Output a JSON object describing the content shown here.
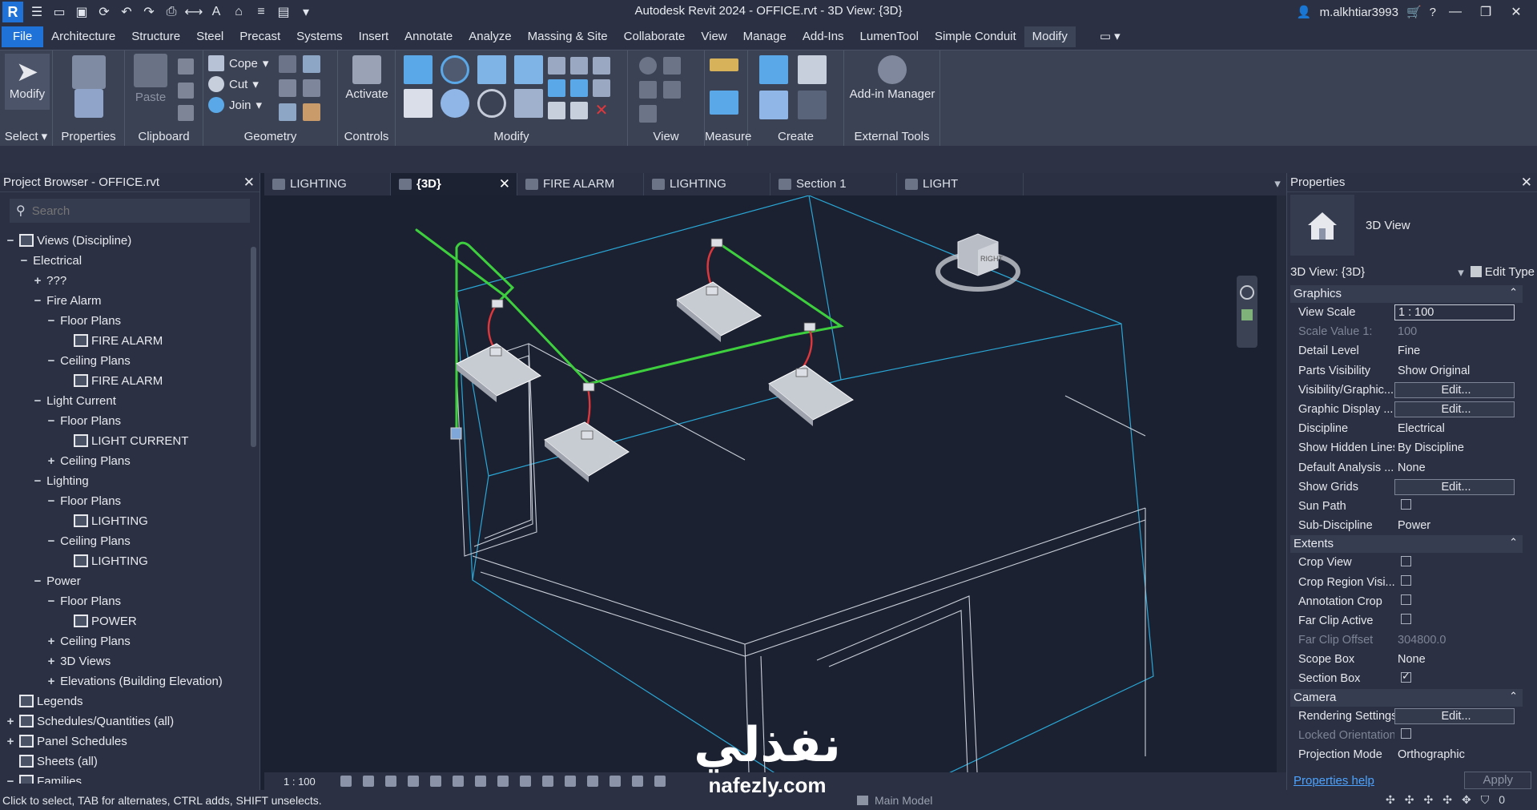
{
  "titlebar": {
    "title": "Autodesk Revit 2024 - OFFICE.rvt - 3D View: {3D}",
    "username": "m.alkhtiar3993"
  },
  "menu": {
    "tabs": [
      "File",
      "Architecture",
      "Structure",
      "Steel",
      "Precast",
      "Systems",
      "Insert",
      "Annotate",
      "Analyze",
      "Massing & Site",
      "Collaborate",
      "View",
      "Manage",
      "Add-Ins",
      "LumenTool",
      "Simple Conduit",
      "Modify"
    ],
    "active": "Modify"
  },
  "ribbon": {
    "modify_label": "Modify",
    "paste_label": "Paste",
    "cope_label": "Cope",
    "cut_label": "Cut",
    "join_label": "Join",
    "activate_label": "Activate",
    "addin_manager_label": "Add-in Manager",
    "panels": {
      "select": "Select",
      "properties": "Properties",
      "clipboard": "Clipboard",
      "geometry": "Geometry",
      "controls": "Controls",
      "modify": "Modify",
      "view": "View",
      "measure": "Measure",
      "create": "Create",
      "external_tools": "External Tools"
    }
  },
  "browser": {
    "title": "Project Browser - OFFICE.rvt",
    "search_placeholder": "Search",
    "items": [
      {
        "label": "Views (Discipline)",
        "level": 0,
        "toggle": "−",
        "icon": "views"
      },
      {
        "label": "Electrical",
        "level": 1,
        "toggle": "−"
      },
      {
        "label": "???",
        "level": 2,
        "toggle": "+"
      },
      {
        "label": "Fire Alarm",
        "level": 2,
        "toggle": "−"
      },
      {
        "label": "Floor Plans",
        "level": 3,
        "toggle": "−"
      },
      {
        "label": "FIRE ALARM",
        "level": 4,
        "icon": "plan"
      },
      {
        "label": "Ceiling Plans",
        "level": 3,
        "toggle": "−"
      },
      {
        "label": "FIRE ALARM",
        "level": 4,
        "icon": "plan"
      },
      {
        "label": "Light Current",
        "level": 2,
        "toggle": "−"
      },
      {
        "label": "Floor Plans",
        "level": 3,
        "toggle": "−"
      },
      {
        "label": "LIGHT CURRENT",
        "level": 4,
        "icon": "plan"
      },
      {
        "label": "Ceiling Plans",
        "level": 3,
        "toggle": "+"
      },
      {
        "label": "Lighting",
        "level": 2,
        "toggle": "−"
      },
      {
        "label": "Floor Plans",
        "level": 3,
        "toggle": "−"
      },
      {
        "label": "LIGHTING",
        "level": 4,
        "icon": "plan"
      },
      {
        "label": "Ceiling Plans",
        "level": 3,
        "toggle": "−"
      },
      {
        "label": "LIGHTING",
        "level": 4,
        "icon": "plan"
      },
      {
        "label": "Power",
        "level": 2,
        "toggle": "−"
      },
      {
        "label": "Floor Plans",
        "level": 3,
        "toggle": "−"
      },
      {
        "label": "POWER",
        "level": 4,
        "icon": "plan"
      },
      {
        "label": "Ceiling Plans",
        "level": 3,
        "toggle": "+"
      },
      {
        "label": "3D Views",
        "level": 3,
        "toggle": "+"
      },
      {
        "label": "Elevations (Building Elevation)",
        "level": 3,
        "toggle": "+"
      },
      {
        "label": "Legends",
        "level": 0,
        "icon": "legend"
      },
      {
        "label": "Schedules/Quantities (all)",
        "level": 0,
        "toggle": "+",
        "icon": "schedule"
      },
      {
        "label": "Panel Schedules",
        "level": 0,
        "toggle": "+",
        "icon": "schedule"
      },
      {
        "label": "Sheets (all)",
        "level": 0,
        "icon": "sheet"
      },
      {
        "label": "Families",
        "level": 0,
        "toggle": "−",
        "icon": "family"
      }
    ]
  },
  "view_tabs": [
    {
      "label": "LIGHTING",
      "active": false
    },
    {
      "label": "{3D}",
      "active": true
    },
    {
      "label": "FIRE ALARM",
      "active": false
    },
    {
      "label": "LIGHTING",
      "active": false
    },
    {
      "label": "Section 1",
      "active": false
    },
    {
      "label": "LIGHT CURRENT",
      "active": false
    }
  ],
  "viewcube_face": "RIGHT",
  "view_control": {
    "scale": "1 : 100"
  },
  "properties": {
    "title": "Properties",
    "type_name": "3D View",
    "instance_selector": "3D View: {3D}",
    "edit_type_label": "Edit Type",
    "groups": [
      {
        "name": "Graphics",
        "rows": [
          {
            "name": "View Scale",
            "value": "1 : 100",
            "kind": "boxed"
          },
          {
            "name": "Scale Value    1:",
            "value": "100",
            "kind": "text",
            "disabled": true
          },
          {
            "name": "Detail Level",
            "value": "Fine",
            "kind": "text"
          },
          {
            "name": "Parts Visibility",
            "value": "Show Original",
            "kind": "text"
          },
          {
            "name": "Visibility/Graphic...",
            "value": "Edit...",
            "kind": "button"
          },
          {
            "name": "Graphic Display ...",
            "value": "Edit...",
            "kind": "button"
          },
          {
            "name": "Discipline",
            "value": "Electrical",
            "kind": "text"
          },
          {
            "name": "Show Hidden Lines",
            "value": "By Discipline",
            "kind": "text"
          },
          {
            "name": "Default Analysis ...",
            "value": "None",
            "kind": "text"
          },
          {
            "name": "Show Grids",
            "value": "Edit...",
            "kind": "button"
          },
          {
            "name": "Sun Path",
            "value": "",
            "kind": "check",
            "checked": false
          },
          {
            "name": "Sub-Discipline",
            "value": "Power",
            "kind": "text"
          }
        ]
      },
      {
        "name": "Extents",
        "rows": [
          {
            "name": "Crop View",
            "value": "",
            "kind": "check",
            "checked": false
          },
          {
            "name": "Crop Region Visi...",
            "value": "",
            "kind": "check",
            "checked": false
          },
          {
            "name": "Annotation Crop",
            "value": "",
            "kind": "check",
            "checked": false
          },
          {
            "name": "Far Clip Active",
            "value": "",
            "kind": "check",
            "checked": false
          },
          {
            "name": "Far Clip Offset",
            "value": "304800.0",
            "kind": "text",
            "disabled": true
          },
          {
            "name": "Scope Box",
            "value": "None",
            "kind": "text"
          },
          {
            "name": "Section Box",
            "value": "",
            "kind": "check",
            "checked": true
          }
        ]
      },
      {
        "name": "Camera",
        "rows": [
          {
            "name": "Rendering Settings",
            "value": "Edit...",
            "kind": "button"
          },
          {
            "name": "Locked Orientation",
            "value": "",
            "kind": "check",
            "checked": false,
            "disabled": true
          },
          {
            "name": "Projection Mode",
            "value": "Orthographic",
            "kind": "text"
          }
        ]
      }
    ],
    "help_link": "Properties help",
    "apply_label": "Apply"
  },
  "statusbar": {
    "hint": "Click to select, TAB for alternates, CTRL adds, SHIFT unselects.",
    "model": "Main Model",
    "filter_count": "0"
  },
  "watermark": {
    "arabic": "نفذلي",
    "latin": "nafezly.com"
  },
  "colors": {
    "accent": "#1f73d8",
    "conduit_green": "#3ecf3e",
    "wire_red": "#e0373c",
    "section_box": "#2aa7d6"
  }
}
